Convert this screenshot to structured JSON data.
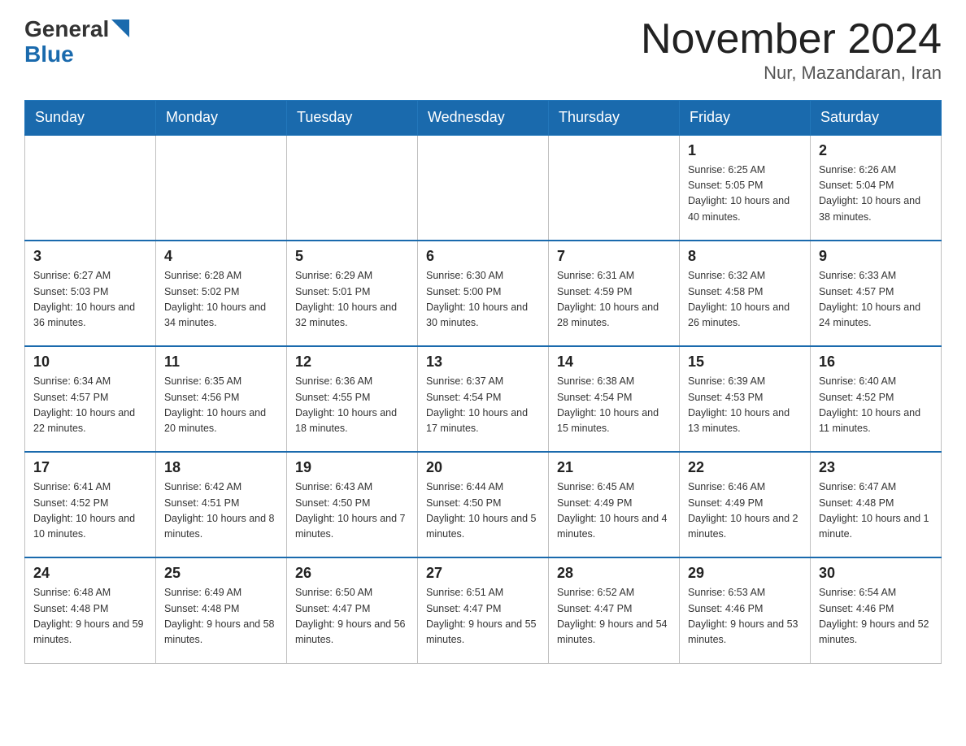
{
  "header": {
    "logo_general": "General",
    "logo_blue": "Blue",
    "month_title": "November 2024",
    "location": "Nur, Mazandaran, Iran"
  },
  "days_of_week": [
    "Sunday",
    "Monday",
    "Tuesday",
    "Wednesday",
    "Thursday",
    "Friday",
    "Saturday"
  ],
  "weeks": [
    [
      {
        "day": "",
        "info": ""
      },
      {
        "day": "",
        "info": ""
      },
      {
        "day": "",
        "info": ""
      },
      {
        "day": "",
        "info": ""
      },
      {
        "day": "",
        "info": ""
      },
      {
        "day": "1",
        "info": "Sunrise: 6:25 AM\nSunset: 5:05 PM\nDaylight: 10 hours and 40 minutes."
      },
      {
        "day": "2",
        "info": "Sunrise: 6:26 AM\nSunset: 5:04 PM\nDaylight: 10 hours and 38 minutes."
      }
    ],
    [
      {
        "day": "3",
        "info": "Sunrise: 6:27 AM\nSunset: 5:03 PM\nDaylight: 10 hours and 36 minutes."
      },
      {
        "day": "4",
        "info": "Sunrise: 6:28 AM\nSunset: 5:02 PM\nDaylight: 10 hours and 34 minutes."
      },
      {
        "day": "5",
        "info": "Sunrise: 6:29 AM\nSunset: 5:01 PM\nDaylight: 10 hours and 32 minutes."
      },
      {
        "day": "6",
        "info": "Sunrise: 6:30 AM\nSunset: 5:00 PM\nDaylight: 10 hours and 30 minutes."
      },
      {
        "day": "7",
        "info": "Sunrise: 6:31 AM\nSunset: 4:59 PM\nDaylight: 10 hours and 28 minutes."
      },
      {
        "day": "8",
        "info": "Sunrise: 6:32 AM\nSunset: 4:58 PM\nDaylight: 10 hours and 26 minutes."
      },
      {
        "day": "9",
        "info": "Sunrise: 6:33 AM\nSunset: 4:57 PM\nDaylight: 10 hours and 24 minutes."
      }
    ],
    [
      {
        "day": "10",
        "info": "Sunrise: 6:34 AM\nSunset: 4:57 PM\nDaylight: 10 hours and 22 minutes."
      },
      {
        "day": "11",
        "info": "Sunrise: 6:35 AM\nSunset: 4:56 PM\nDaylight: 10 hours and 20 minutes."
      },
      {
        "day": "12",
        "info": "Sunrise: 6:36 AM\nSunset: 4:55 PM\nDaylight: 10 hours and 18 minutes."
      },
      {
        "day": "13",
        "info": "Sunrise: 6:37 AM\nSunset: 4:54 PM\nDaylight: 10 hours and 17 minutes."
      },
      {
        "day": "14",
        "info": "Sunrise: 6:38 AM\nSunset: 4:54 PM\nDaylight: 10 hours and 15 minutes."
      },
      {
        "day": "15",
        "info": "Sunrise: 6:39 AM\nSunset: 4:53 PM\nDaylight: 10 hours and 13 minutes."
      },
      {
        "day": "16",
        "info": "Sunrise: 6:40 AM\nSunset: 4:52 PM\nDaylight: 10 hours and 11 minutes."
      }
    ],
    [
      {
        "day": "17",
        "info": "Sunrise: 6:41 AM\nSunset: 4:52 PM\nDaylight: 10 hours and 10 minutes."
      },
      {
        "day": "18",
        "info": "Sunrise: 6:42 AM\nSunset: 4:51 PM\nDaylight: 10 hours and 8 minutes."
      },
      {
        "day": "19",
        "info": "Sunrise: 6:43 AM\nSunset: 4:50 PM\nDaylight: 10 hours and 7 minutes."
      },
      {
        "day": "20",
        "info": "Sunrise: 6:44 AM\nSunset: 4:50 PM\nDaylight: 10 hours and 5 minutes."
      },
      {
        "day": "21",
        "info": "Sunrise: 6:45 AM\nSunset: 4:49 PM\nDaylight: 10 hours and 4 minutes."
      },
      {
        "day": "22",
        "info": "Sunrise: 6:46 AM\nSunset: 4:49 PM\nDaylight: 10 hours and 2 minutes."
      },
      {
        "day": "23",
        "info": "Sunrise: 6:47 AM\nSunset: 4:48 PM\nDaylight: 10 hours and 1 minute."
      }
    ],
    [
      {
        "day": "24",
        "info": "Sunrise: 6:48 AM\nSunset: 4:48 PM\nDaylight: 9 hours and 59 minutes."
      },
      {
        "day": "25",
        "info": "Sunrise: 6:49 AM\nSunset: 4:48 PM\nDaylight: 9 hours and 58 minutes."
      },
      {
        "day": "26",
        "info": "Sunrise: 6:50 AM\nSunset: 4:47 PM\nDaylight: 9 hours and 56 minutes."
      },
      {
        "day": "27",
        "info": "Sunrise: 6:51 AM\nSunset: 4:47 PM\nDaylight: 9 hours and 55 minutes."
      },
      {
        "day": "28",
        "info": "Sunrise: 6:52 AM\nSunset: 4:47 PM\nDaylight: 9 hours and 54 minutes."
      },
      {
        "day": "29",
        "info": "Sunrise: 6:53 AM\nSunset: 4:46 PM\nDaylight: 9 hours and 53 minutes."
      },
      {
        "day": "30",
        "info": "Sunrise: 6:54 AM\nSunset: 4:46 PM\nDaylight: 9 hours and 52 minutes."
      }
    ]
  ]
}
